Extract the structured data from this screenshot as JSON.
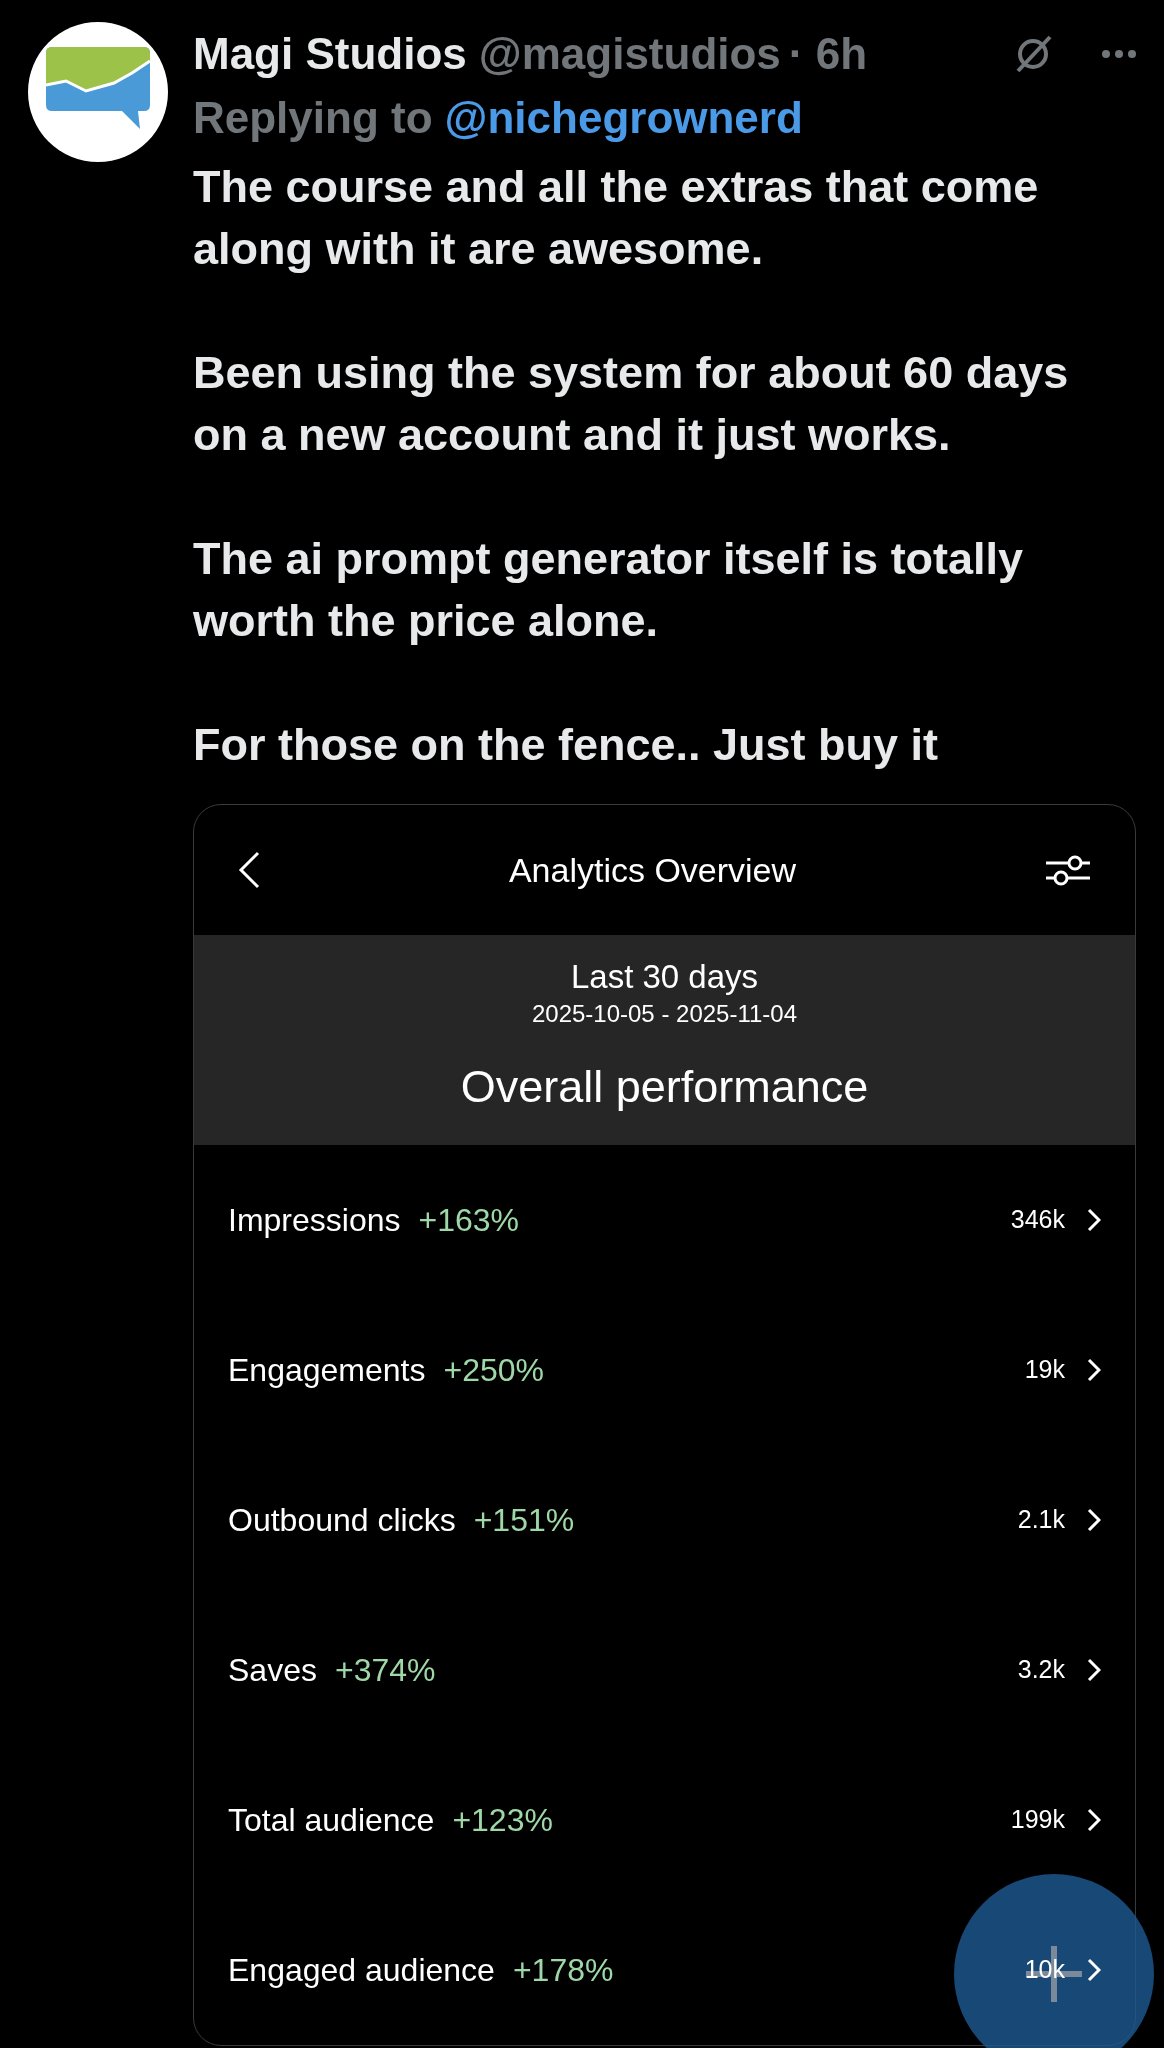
{
  "post": {
    "author": "Magi Studios",
    "handle": "@magistudios",
    "time": "· 6h",
    "replying_label": "Replying to",
    "replying_to": "@nichegrownerd",
    "paragraphs": [
      "The course and all the extras that come along with it are awesome.",
      "Been using the system for about 60 days on a new account and it just works.",
      "The ai prompt generator itself is totally worth the price alone.",
      "For those on the fence.. Just buy it"
    ]
  },
  "analytics": {
    "title": "Analytics Overview",
    "period": "Last 30 days",
    "dates": "2025-10-05 - 2025-11-04",
    "heading": "Overall performance",
    "metrics": [
      {
        "label": "Impressions",
        "change": "+163%",
        "value": "346k"
      },
      {
        "label": "Engagements",
        "change": "+250%",
        "value": "19k"
      },
      {
        "label": "Outbound clicks",
        "change": "+151%",
        "value": "2.1k"
      },
      {
        "label": "Saves",
        "change": "+374%",
        "value": "3.2k"
      },
      {
        "label": "Total audience",
        "change": "+123%",
        "value": "199k"
      },
      {
        "label": "Engaged audience",
        "change": "+178%",
        "value": "10k"
      }
    ]
  }
}
